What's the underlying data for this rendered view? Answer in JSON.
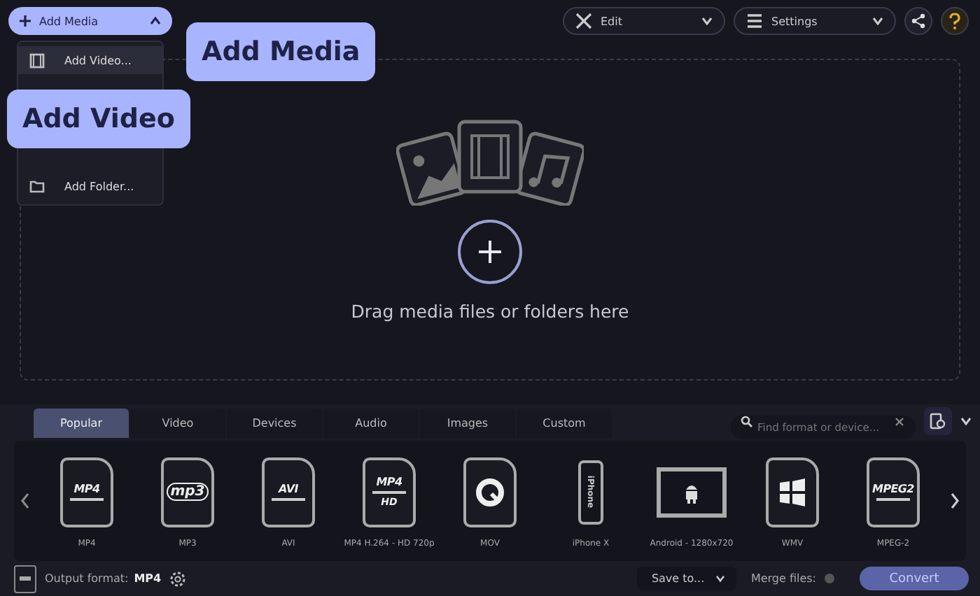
{
  "toolbar": {
    "add_media": "Add Media",
    "edit": "Edit",
    "settings": "Settings"
  },
  "menu": {
    "items": [
      {
        "label": "Add Video...",
        "selected": true,
        "kind": "video"
      },
      {
        "label": "Add Folder...",
        "selected": false,
        "kind": "folder"
      }
    ]
  },
  "callouts": [
    {
      "text": "Add Media",
      "kind": "right"
    },
    {
      "text": "Add Video",
      "kind": "below"
    }
  ],
  "drop_zone": {
    "hint": "Drag media files or folders here"
  },
  "tabs": [
    {
      "label": "Popular",
      "selected": true
    },
    {
      "label": "Video",
      "selected": false
    },
    {
      "label": "Devices",
      "selected": false
    },
    {
      "label": "Audio",
      "selected": false
    },
    {
      "label": "Images",
      "selected": false
    },
    {
      "label": "Custom",
      "selected": false
    }
  ],
  "search": {
    "placeholder": "Find format or device..."
  },
  "formats": [
    {
      "kind": "doc",
      "badge": "MP4",
      "label": "MP4"
    },
    {
      "kind": "mp3",
      "badge": "mp3",
      "label": "MP3"
    },
    {
      "kind": "doc",
      "badge": "AVI",
      "label": "AVI"
    },
    {
      "kind": "hd",
      "badge": "MP4",
      "sub": "HD",
      "label": "MP4 H.264 - HD 720p"
    },
    {
      "kind": "mov",
      "label": "MOV"
    },
    {
      "kind": "phone",
      "badge": "iPhone",
      "label": "iPhone X"
    },
    {
      "kind": "tablet",
      "label": "Android - 1280x720"
    },
    {
      "kind": "windows",
      "label": "WMV"
    },
    {
      "kind": "doc",
      "badge": "MPEG2",
      "label": "MPEG-2"
    }
  ],
  "footer": {
    "output_label": "Output format:",
    "output_value": "MP4",
    "save_to": "Save to...",
    "merge_label": "Merge files:",
    "merge_on": false,
    "convert": "Convert"
  }
}
